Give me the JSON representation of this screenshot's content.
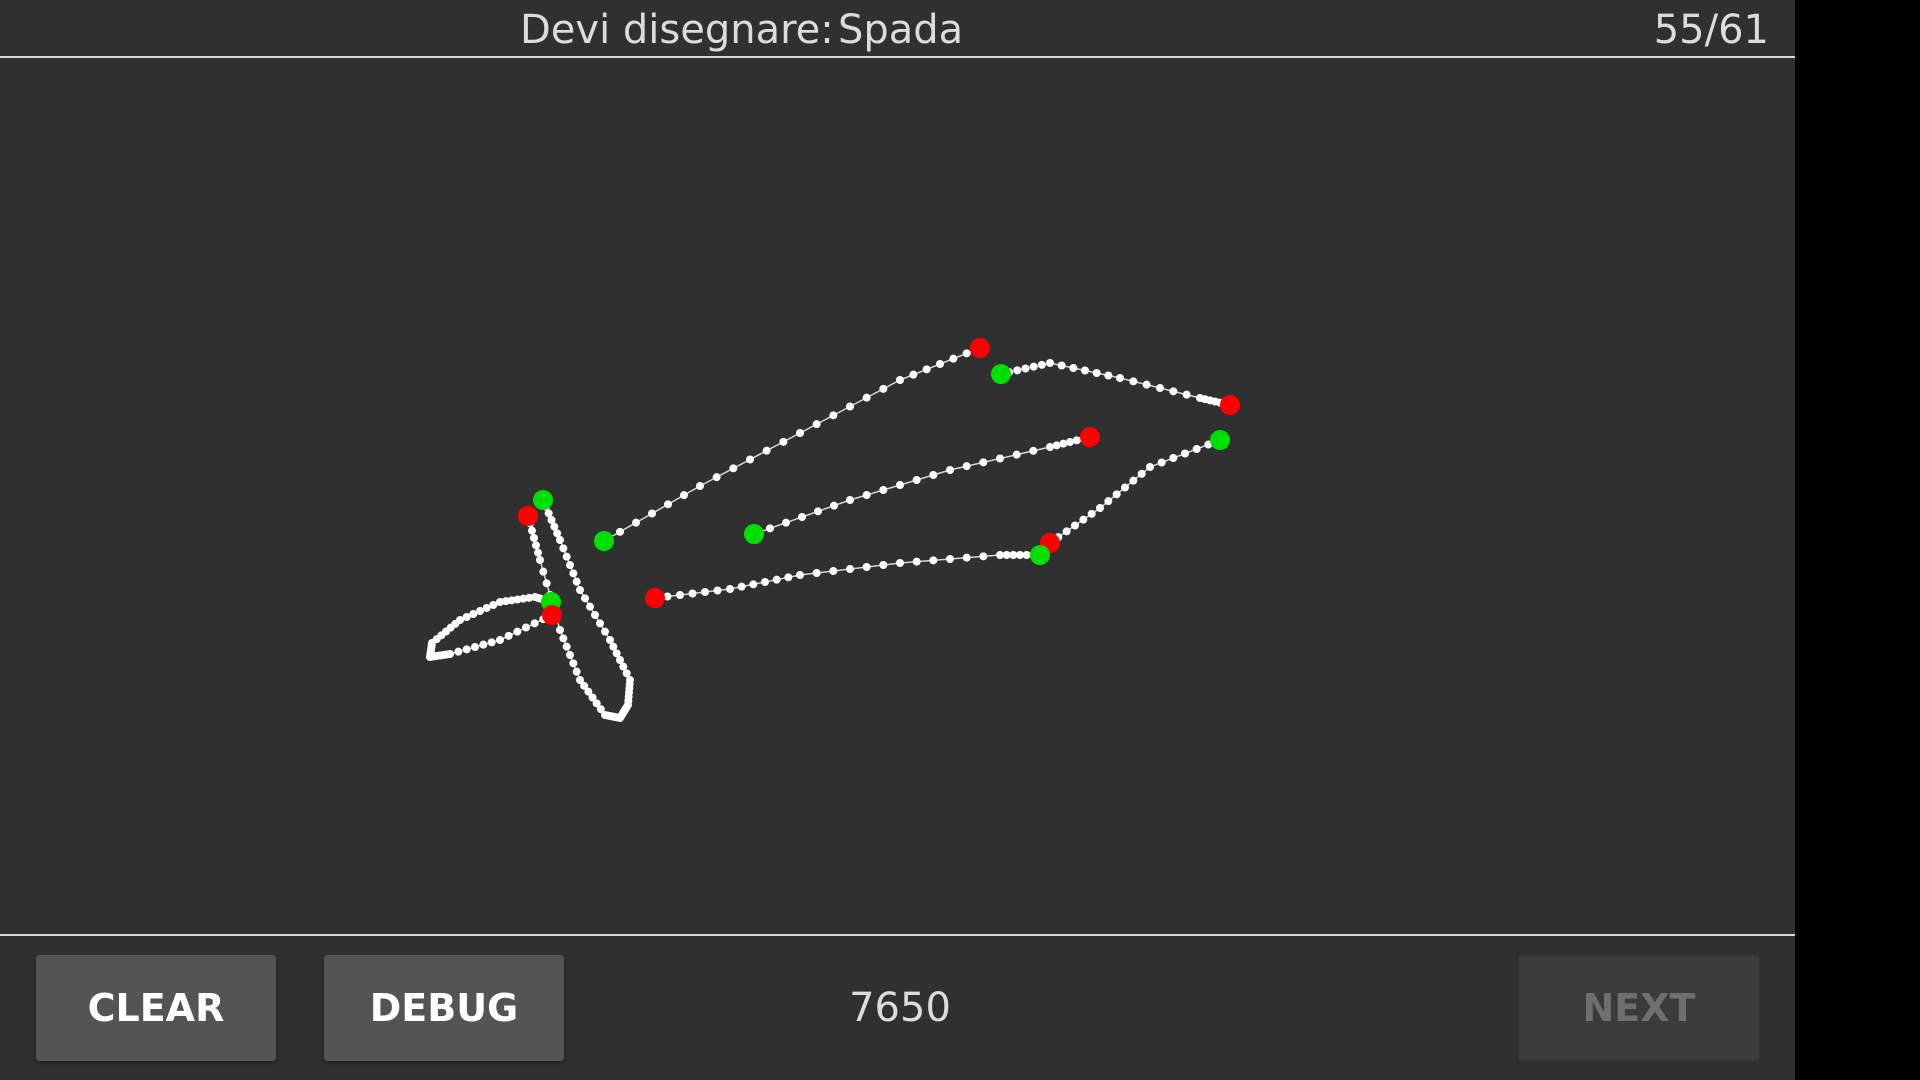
{
  "header": {
    "prompt": "Devi disegnare:",
    "word": "Spada",
    "progress": "55/61"
  },
  "footer": {
    "clear_label": "CLEAR",
    "debug_label": "DEBUG",
    "score": "7650",
    "next_label": "NEXT"
  },
  "colors": {
    "background": "#303030",
    "stroke": "#ffffff",
    "stroke_start": "#00e000",
    "stroke_end": "#ff0000"
  }
}
